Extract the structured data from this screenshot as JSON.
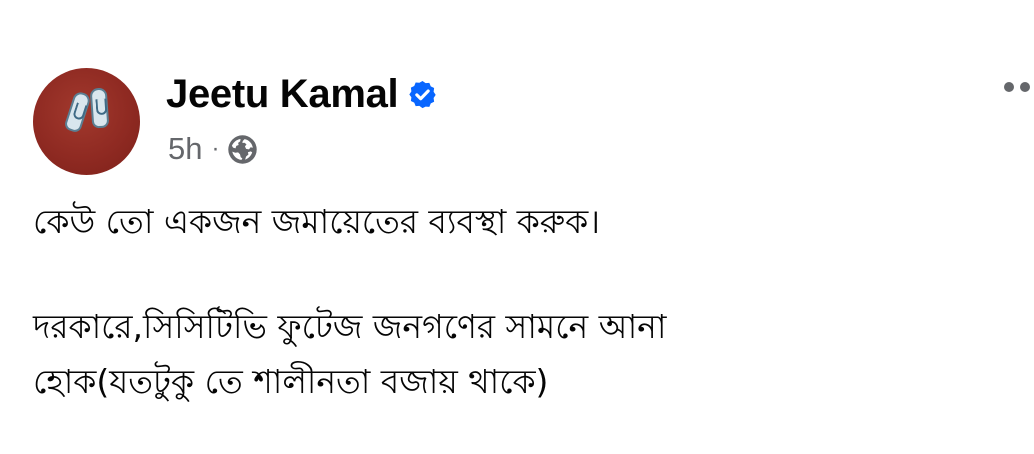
{
  "post": {
    "author_name": "Jeetu Kamal",
    "verified_icon": "verified-badge-icon",
    "timestamp": "5h",
    "separator": "·",
    "audience_icon": "globe-icon",
    "more_icon": "more-options-icon",
    "body_lines": [
      "কেউ তো একজন জমায়েতের ব্যবস্থা করুক।",
      "দরকারে,সিসিটিভি ফুটেজ জনগণের সামনে আনা",
      "হোক(যতটুকু তে শালীনতা বজায় থাকে)"
    ]
  },
  "colors": {
    "verified_blue": "#0866ff",
    "secondary_text": "#65676b",
    "primary_text": "#050505",
    "avatar_background": "#8f2a22"
  }
}
